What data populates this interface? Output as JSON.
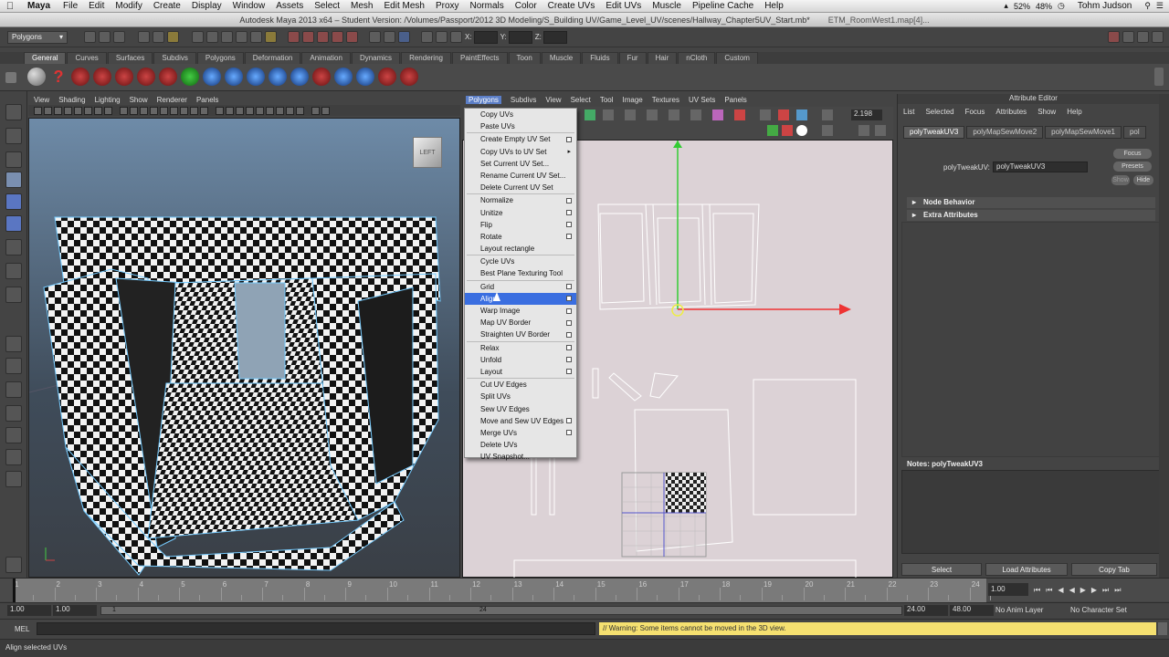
{
  "menubar": {
    "app": "Maya",
    "items": [
      "File",
      "Edit",
      "Modify",
      "Create",
      "Display",
      "Window",
      "Assets",
      "Select",
      "Mesh",
      "Edit Mesh",
      "Proxy",
      "Normals",
      "Color",
      "Create UVs",
      "Edit UVs",
      "Muscle",
      "Pipeline Cache",
      "Help"
    ],
    "battery": "52%",
    "volume": "48%",
    "user": "Tohm Judson"
  },
  "titlebar": {
    "title": "Autodesk Maya 2013 x64 – Student Version: /Volumes/Passport/2012 3D Modeling/S_Building UV/Game_Level_UV/scenes/Hallway_Chapter5UV_Start.mb*",
    "window2": "ETM_RoomWest1.map[4]..."
  },
  "statusline": {
    "mode": "Polygons",
    "x_label": "X:",
    "y_label": "Y:",
    "z_label": "Z:"
  },
  "shelf": {
    "tabs": [
      "General",
      "Curves",
      "Surfaces",
      "Subdivs",
      "Polygons",
      "Deformation",
      "Animation",
      "Dynamics",
      "Rendering",
      "PaintEffects",
      "Toon",
      "Muscle",
      "Fluids",
      "Fur",
      "Hair",
      "nCloth",
      "Custom"
    ]
  },
  "persp": {
    "menu": [
      "View",
      "Shading",
      "Lighting",
      "Show",
      "Renderer",
      "Panels"
    ],
    "cube_label": "LEFT"
  },
  "uv_editor": {
    "menu": [
      "Polygons",
      "Subdivs",
      "View",
      "Select",
      "Tool",
      "Image",
      "Textures",
      "UV Sets",
      "Panels"
    ],
    "zoom_value": "2.198"
  },
  "polygons_menu": {
    "items": [
      {
        "label": "Copy UVs"
      },
      {
        "label": "Paste UVs"
      },
      {
        "label": "Create Empty UV Set",
        "box": true
      },
      {
        "label": "Copy UVs to UV Set",
        "sub": true
      },
      {
        "label": "Set Current UV Set..."
      },
      {
        "label": "Rename Current UV Set..."
      },
      {
        "label": "Delete Current UV Set"
      },
      {
        "label": "Normalize",
        "box": true
      },
      {
        "label": "Unitize",
        "box": true
      },
      {
        "label": "Flip",
        "box": true
      },
      {
        "label": "Rotate",
        "box": true
      },
      {
        "label": "Layout rectangle"
      },
      {
        "label": "Cycle UVs"
      },
      {
        "label": "Best Plane Texturing Tool"
      },
      {
        "label": "Grid",
        "box": true
      },
      {
        "label": "Align",
        "box": true,
        "highlight": true
      },
      {
        "label": "Warp Image",
        "box": true
      },
      {
        "label": "Map UV Border",
        "box": true
      },
      {
        "label": "Straighten UV Border",
        "box": true
      },
      {
        "label": "Relax",
        "box": true
      },
      {
        "label": "Unfold",
        "box": true
      },
      {
        "label": "Layout",
        "box": true
      },
      {
        "label": "Cut UV Edges"
      },
      {
        "label": "Split UVs"
      },
      {
        "label": "Sew UV Edges"
      },
      {
        "label": "Move and Sew UV Edges",
        "box": true
      },
      {
        "label": "Merge UVs",
        "box": true
      },
      {
        "label": "Delete UVs"
      },
      {
        "label": "UV Snapshot..."
      }
    ]
  },
  "attribute_editor": {
    "title": "Attribute Editor",
    "menu": [
      "List",
      "Selected",
      "Focus",
      "Attributes",
      "Show",
      "Help"
    ],
    "tabs": [
      "polyTweakUV3",
      "polyMapSewMove2",
      "polyMapSewMove1",
      "pol"
    ],
    "field_label": "polyTweakUV:",
    "field_value": "polyTweakUV3",
    "focus_btn": "Focus",
    "presets_btn": "Presets",
    "show_btn": "Show",
    "hide_btn": "Hide",
    "sections": [
      "Node Behavior",
      "Extra Attributes"
    ],
    "notes_label": "Notes:  polyTweakUV3",
    "buttons": [
      "Select",
      "Load Attributes",
      "Copy Tab"
    ]
  },
  "time_slider": {
    "ticks": [
      "1",
      "2",
      "3",
      "4",
      "5",
      "6",
      "7",
      "8",
      "9",
      "10",
      "11",
      "12",
      "13",
      "14",
      "15",
      "16",
      "17",
      "18",
      "19",
      "20",
      "21",
      "22",
      "23",
      "24"
    ],
    "current_frame": "1.00"
  },
  "range_slider": {
    "start": "1.00",
    "inner_start": "1.00",
    "range_start_marker": "1",
    "range_end_marker": "24",
    "end": "24.00",
    "anim_end": "48.00",
    "anim_layer": "No Anim Layer",
    "char_set": "No Character Set"
  },
  "command_line": {
    "label": "MEL",
    "warning": "// Warning: Some items cannot be moved in the 3D view."
  },
  "help_line": {
    "text": "Align selected UVs"
  }
}
